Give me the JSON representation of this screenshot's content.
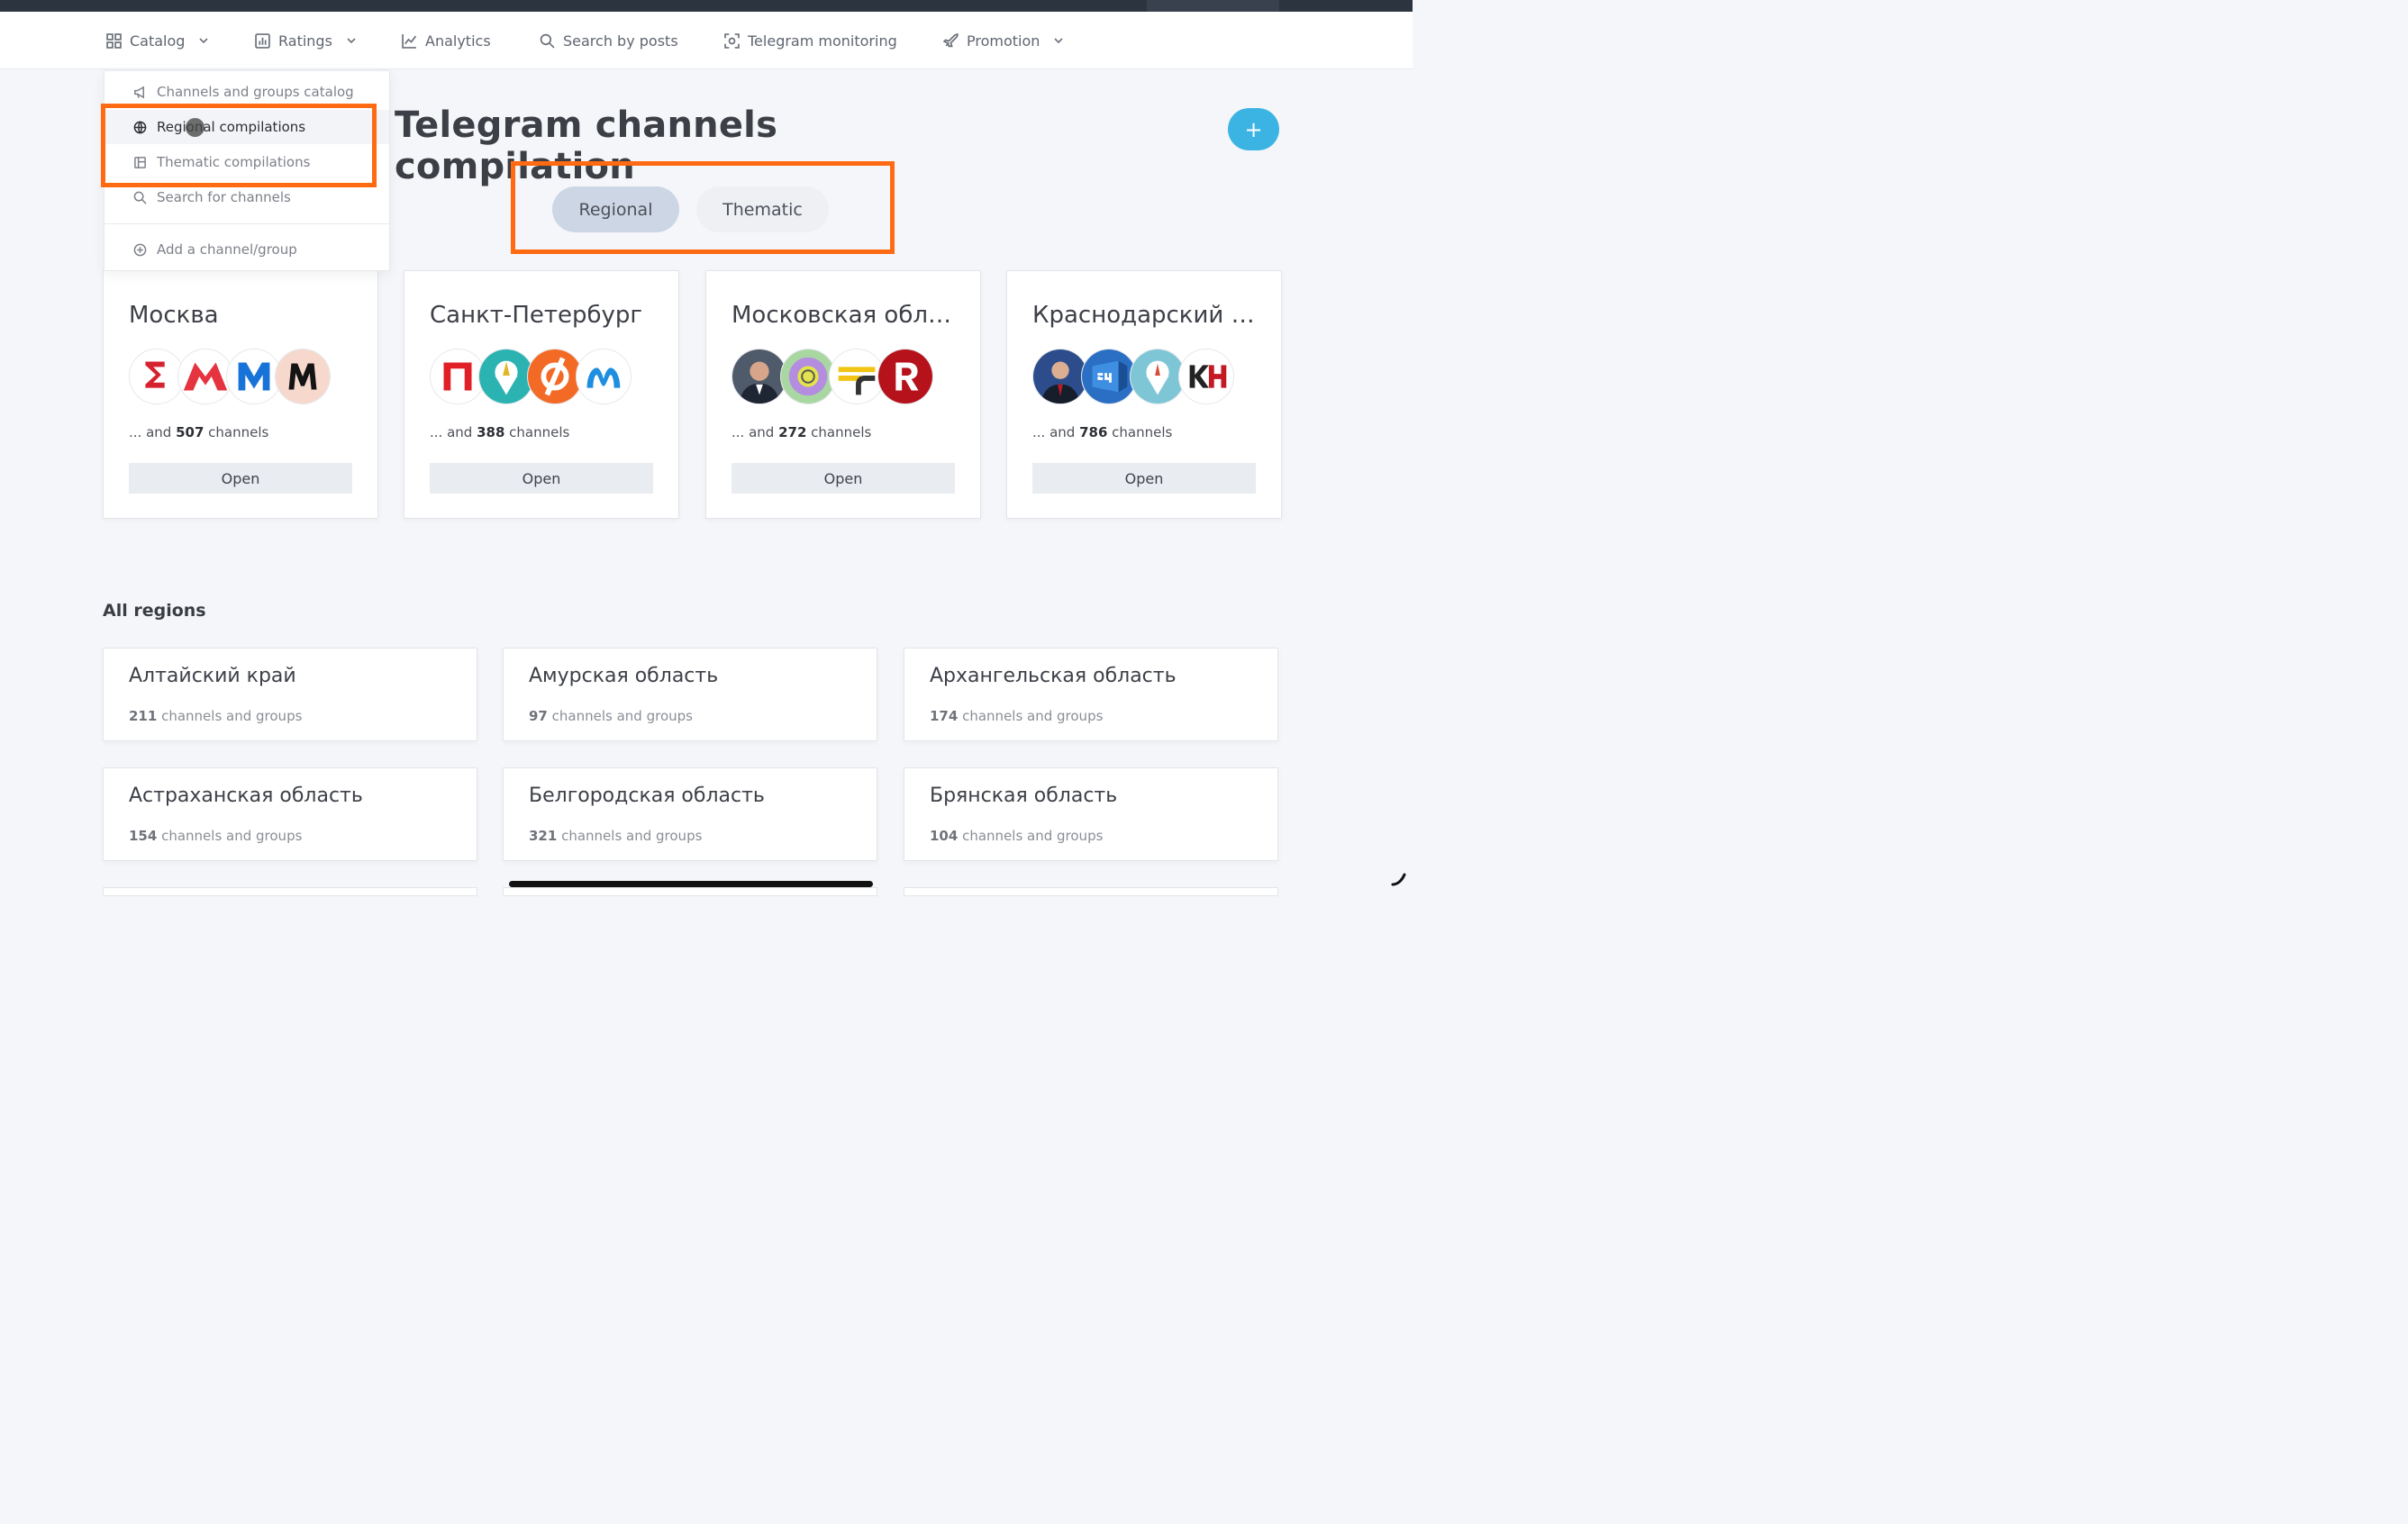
{
  "nav": {
    "items": [
      {
        "label": "Catalog",
        "icon": "grid-icon",
        "has_chevron": true
      },
      {
        "label": "Ratings",
        "icon": "bar-chart-icon",
        "has_chevron": true
      },
      {
        "label": "Analytics",
        "icon": "line-chart-icon",
        "has_chevron": false
      },
      {
        "label": "Search by posts",
        "icon": "search-icon",
        "has_chevron": false
      },
      {
        "label": "Telegram monitoring",
        "icon": "scan-icon",
        "has_chevron": false
      },
      {
        "label": "Promotion",
        "icon": "rocket-icon",
        "has_chevron": true
      }
    ]
  },
  "dropdown": {
    "items": [
      {
        "label": "Channels and groups catalog",
        "icon": "megaphone-icon"
      },
      {
        "label": "Regional compilations",
        "icon": "globe-icon",
        "active": true
      },
      {
        "label": "Thematic compilations",
        "icon": "book-icon"
      },
      {
        "label": "Search for channels",
        "icon": "search-icon"
      },
      {
        "label": "Add a channel/group",
        "icon": "plus-circle-icon"
      }
    ]
  },
  "page": {
    "title": "Telegram channels compilation",
    "add_button": "+",
    "tabs": [
      "Regional",
      "Thematic"
    ]
  },
  "featured": [
    {
      "name": "Москва",
      "prefix": "... and",
      "count": "507",
      "suffix": "channels",
      "open": "Open"
    },
    {
      "name": "Санкт-Петербург",
      "prefix": "... and",
      "count": "388",
      "suffix": "channels",
      "open": "Open"
    },
    {
      "name": "Московская обла...",
      "prefix": "... and",
      "count": "272",
      "suffix": "channels",
      "open": "Open"
    },
    {
      "name": "Краснодарский к...",
      "prefix": "... and",
      "count": "786",
      "suffix": "channels",
      "open": "Open"
    }
  ],
  "all_regions": {
    "title": "All regions",
    "items": [
      {
        "name": "Алтайский край",
        "count": "211",
        "suffix": "channels and groups"
      },
      {
        "name": "Амурская область",
        "count": "97",
        "suffix": "channels and groups"
      },
      {
        "name": "Архангельская область",
        "count": "174",
        "suffix": "channels and groups"
      },
      {
        "name": "Астраханская область",
        "count": "154",
        "suffix": "channels and groups"
      },
      {
        "name": "Белгородская область",
        "count": "321",
        "suffix": "channels and groups"
      },
      {
        "name": "Брянская область",
        "count": "104",
        "suffix": "channels and groups"
      }
    ]
  },
  "colors": {
    "accent": "#3cb4e3",
    "highlight": "#ff6a13",
    "tab_active": "#cdd6e4",
    "tab_inactive": "#eef0f4"
  }
}
